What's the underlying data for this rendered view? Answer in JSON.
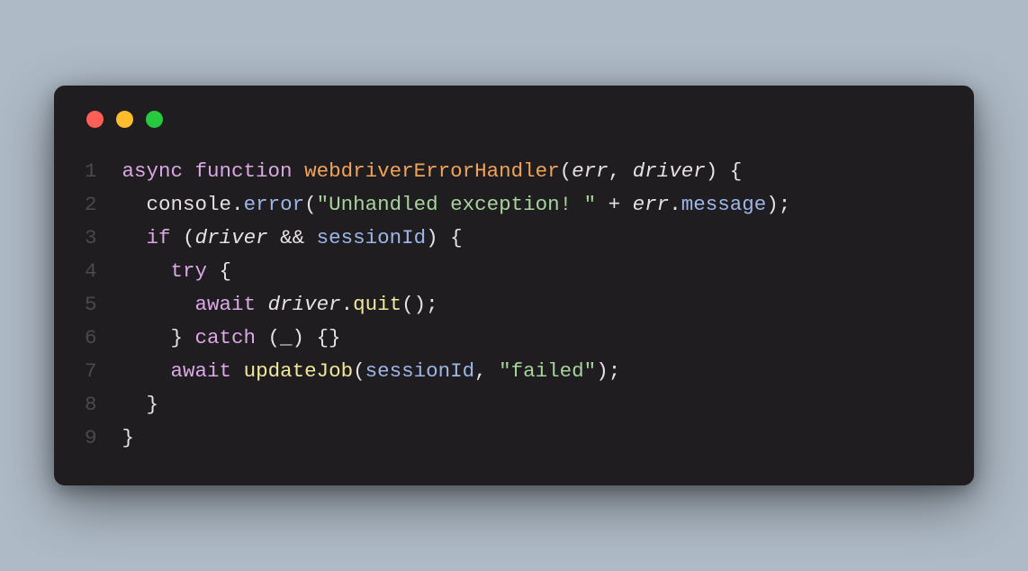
{
  "colors": {
    "page_bg": "#aebac6",
    "window_bg": "#1f1d1f",
    "red": "#ff5f56",
    "yellow": "#ffbd2e",
    "green": "#27c93f",
    "gutter": "#4a4a4a",
    "default": "#e6e1e6",
    "keyword": "#dba8e6",
    "fn_declaration": "#f0a35a",
    "member": "#9db6e8",
    "call": "#f0e89a",
    "string": "#a6d49c"
  },
  "gutter": [
    "1",
    "2",
    "3",
    "4",
    "5",
    "6",
    "7",
    "8",
    "9"
  ],
  "lines": [
    [
      {
        "t": "async",
        "c": "kw"
      },
      {
        "t": " ",
        "c": "plain"
      },
      {
        "t": "function",
        "c": "kw"
      },
      {
        "t": " ",
        "c": "plain"
      },
      {
        "t": "webdriverErrorHandler",
        "c": "fn-decl"
      },
      {
        "t": "(",
        "c": "plain"
      },
      {
        "t": "err",
        "c": "param"
      },
      {
        "t": ", ",
        "c": "plain"
      },
      {
        "t": "driver",
        "c": "param"
      },
      {
        "t": ") {",
        "c": "plain"
      }
    ],
    [
      {
        "t": "  console",
        "c": "obj"
      },
      {
        "t": ".",
        "c": "plain"
      },
      {
        "t": "error",
        "c": "member"
      },
      {
        "t": "(",
        "c": "plain"
      },
      {
        "t": "\"Unhandled exception! \"",
        "c": "str"
      },
      {
        "t": " + ",
        "c": "plain"
      },
      {
        "t": "err",
        "c": "param"
      },
      {
        "t": ".",
        "c": "plain"
      },
      {
        "t": "message",
        "c": "member"
      },
      {
        "t": ");",
        "c": "plain"
      }
    ],
    [
      {
        "t": "  ",
        "c": "plain"
      },
      {
        "t": "if",
        "c": "kw"
      },
      {
        "t": " (",
        "c": "plain"
      },
      {
        "t": "driver",
        "c": "param"
      },
      {
        "t": " && ",
        "c": "plain"
      },
      {
        "t": "sessionId",
        "c": "ident"
      },
      {
        "t": ") {",
        "c": "plain"
      }
    ],
    [
      {
        "t": "    ",
        "c": "plain"
      },
      {
        "t": "try",
        "c": "kw"
      },
      {
        "t": " {",
        "c": "plain"
      }
    ],
    [
      {
        "t": "      ",
        "c": "plain"
      },
      {
        "t": "await",
        "c": "kw"
      },
      {
        "t": " ",
        "c": "plain"
      },
      {
        "t": "driver",
        "c": "param"
      },
      {
        "t": ".",
        "c": "plain"
      },
      {
        "t": "quit",
        "c": "call"
      },
      {
        "t": "();",
        "c": "plain"
      }
    ],
    [
      {
        "t": "    } ",
        "c": "plain"
      },
      {
        "t": "catch",
        "c": "kw"
      },
      {
        "t": " (_) {}",
        "c": "plain"
      }
    ],
    [
      {
        "t": "    ",
        "c": "plain"
      },
      {
        "t": "await",
        "c": "kw"
      },
      {
        "t": " ",
        "c": "plain"
      },
      {
        "t": "updateJob",
        "c": "call"
      },
      {
        "t": "(",
        "c": "plain"
      },
      {
        "t": "sessionId",
        "c": "ident"
      },
      {
        "t": ", ",
        "c": "plain"
      },
      {
        "t": "\"failed\"",
        "c": "str"
      },
      {
        "t": ");",
        "c": "plain"
      }
    ],
    [
      {
        "t": "  }",
        "c": "plain"
      }
    ],
    [
      {
        "t": "}",
        "c": "plain"
      }
    ]
  ]
}
